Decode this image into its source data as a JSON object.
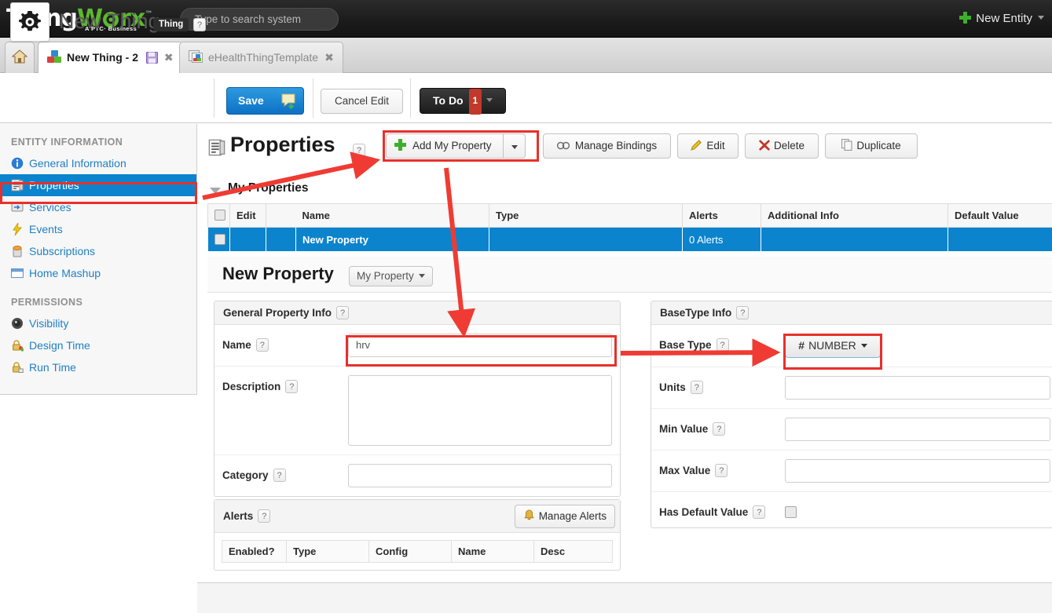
{
  "topbar": {
    "brand_ting": "Thing",
    "brand_w": "W",
    "brand_rx": "rx",
    "brand_tm": "™",
    "brand_sub": "A PTC· Business",
    "search_placeholder": "Type to search system",
    "search_value": "",
    "new_entity_label": "New Entity",
    "new_entity_icon": "plus-icon",
    "new_entity_caret": "chevron-down-icon"
  },
  "tabs": {
    "home_icon": "home-icon",
    "items": [
      {
        "label": "New Thing - 2",
        "icon": "thing-blocks-icon",
        "extra_icon": "save-disk-icon",
        "close": "✖",
        "active": true
      },
      {
        "label": "eHealthThingTemplate",
        "icon": "thing-template-icon",
        "extra_icon": "",
        "close": "✖",
        "active": false
      }
    ]
  },
  "entity_header": {
    "gear_icon": "gear-icon",
    "title": "New Thing",
    "type_badge": "Thing",
    "help": "?",
    "save_label": "Save",
    "save_chat_icon": "chat-bubble-icon",
    "cancel_label": "Cancel Edit",
    "todo_label": "To Do",
    "todo_count": "1",
    "todo_caret": "chevron-down-icon"
  },
  "sidebar": {
    "groups": [
      {
        "title": "ENTITY INFORMATION",
        "items": [
          {
            "label": "General Information",
            "icon": "info-icon",
            "selected": false
          },
          {
            "label": "Properties",
            "icon": "properties-list-icon",
            "selected": true
          },
          {
            "label": "Services",
            "icon": "services-icon",
            "selected": false
          },
          {
            "label": "Events",
            "icon": "lightning-icon",
            "selected": false
          },
          {
            "label": "Subscriptions",
            "icon": "subscriptions-icon",
            "selected": false
          },
          {
            "label": "Home Mashup",
            "icon": "mashup-window-icon",
            "selected": false
          }
        ]
      },
      {
        "title": "PERMISSIONS",
        "items": [
          {
            "label": "Visibility",
            "icon": "eye-icon",
            "selected": false
          },
          {
            "label": "Design Time",
            "icon": "lock-design-icon",
            "selected": false
          },
          {
            "label": "Run Time",
            "icon": "lock-run-icon",
            "selected": false
          }
        ]
      }
    ]
  },
  "properties": {
    "page_icon": "properties-list-icon",
    "page_title": "Properties",
    "help": "?",
    "toolbar": [
      {
        "label": "Add My Property",
        "icon": "plus-icon",
        "split_caret": true
      },
      {
        "label": "Manage Bindings",
        "icon": "bindings-icon",
        "split_caret": false
      },
      {
        "label": "Edit",
        "icon": "pencil-icon",
        "split_caret": false
      },
      {
        "label": "Delete",
        "icon": "red-x-icon",
        "split_caret": false
      },
      {
        "label": "Duplicate",
        "icon": "copy-icon",
        "split_caret": false
      }
    ],
    "section_label": "My Properties",
    "section_caret": "triangle-down-icon",
    "table": {
      "columns": [
        "",
        "Edit",
        "Name",
        "Type",
        "Alerts",
        "Additional Info",
        "Default Value"
      ],
      "rows": [
        {
          "checkbox": "",
          "edit": "",
          "name": "New Property",
          "type": "",
          "alerts": "0 Alerts",
          "additional_info": "",
          "default_value": ""
        }
      ]
    }
  },
  "editor": {
    "title": "New Property",
    "scope_select": "My Property",
    "scope_caret": "chevron-down-icon",
    "general": {
      "panel_title": "General Property Info",
      "help": "?",
      "fields": [
        {
          "label": "Name",
          "help": "?",
          "value": "hrv",
          "type": "input"
        },
        {
          "label": "Description",
          "help": "?",
          "value": "",
          "type": "textarea"
        },
        {
          "label": "Category",
          "help": "?",
          "value": "",
          "type": "input"
        }
      ]
    },
    "alerts": {
      "panel_title": "Alerts",
      "help": "?",
      "manage_label": "Manage Alerts",
      "manage_icon": "bell-icon",
      "columns": [
        "Enabled?",
        "Type",
        "Config",
        "Name",
        "Desc"
      ]
    },
    "basetype": {
      "panel_title": "BaseType Info",
      "help": "?",
      "base_type_label": "Base Type",
      "base_type_help": "?",
      "base_type_value": "NUMBER",
      "base_type_icon": "hash-icon",
      "base_type_caret": "chevron-down-icon",
      "fields": [
        {
          "label": "Units",
          "help": "?",
          "value": "",
          "type": "input"
        },
        {
          "label": "Min Value",
          "help": "?",
          "value": "",
          "type": "input"
        },
        {
          "label": "Max Value",
          "help": "?",
          "value": "",
          "type": "input"
        },
        {
          "label": "Has Default Value",
          "help": "?",
          "value": "",
          "type": "checkbox"
        }
      ]
    }
  },
  "annotations": {
    "accent_red": "#e8302a",
    "highlight_blue": "#0b84cd",
    "brand_green": "#5bb92d"
  }
}
